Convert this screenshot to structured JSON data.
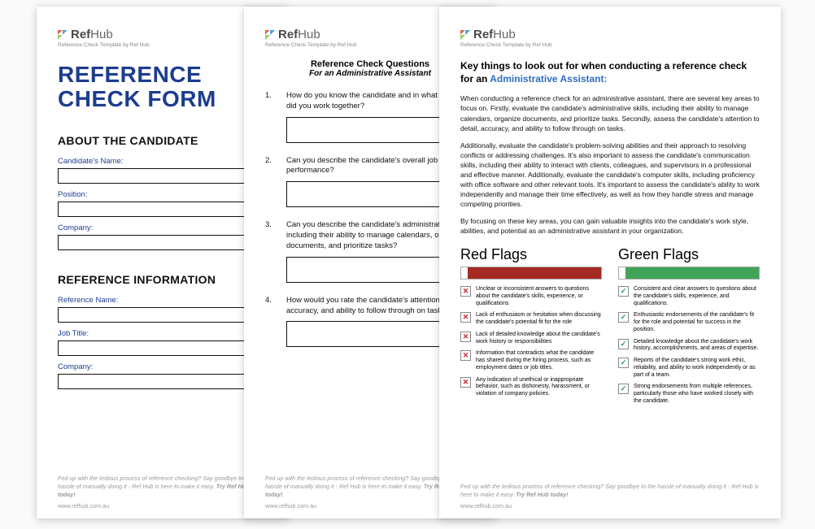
{
  "brand": {
    "name_bold": "Ref",
    "name_thin": "Hub",
    "tagline": "Reference Check Template by Ref Hub"
  },
  "footer": {
    "line": "Fed up with the tedious process of reference checking? Say goodbye to the hassle of manually doing it - Ref Hub is here to make it easy.",
    "cta": "Try Ref Hub today!",
    "url": "www.refhub.com.au"
  },
  "page1": {
    "title_l1": "REFERENCE",
    "title_l2": "CHECK FORM",
    "section_about": "ABOUT THE CANDIDATE",
    "fields_about": [
      "Candidate's Name:",
      "Position:",
      "Company:"
    ],
    "section_ref": "REFERENCE INFORMATION",
    "fields_ref": [
      "Reference Name:",
      "Job Title:",
      "Company:"
    ]
  },
  "page2": {
    "heading_l1": "Reference Check Questions",
    "heading_l2": "For an Administrative Assistant",
    "questions": [
      "How do you know the candidate and in what capacity did you work together?",
      "Can you describe the candidate's overall job performance?",
      "Can you describe the candidate's administrative skills, including their ability to manage calendars, organize documents, and prioritize tasks?",
      "How would you rate the candidate's attention to detail, accuracy, and ability to follow through on tasks?"
    ]
  },
  "page3": {
    "title_pre": "Key things to look out for when conducting a reference check for an ",
    "title_role": "Administrative Assistant:",
    "paras": [
      "When conducting a reference check for an administrative assistant, there are several key areas to focus on. Firstly, evaluate the candidate's administrative skills, including their ability to manage calendars, organize documents, and prioritize tasks. Secondly, assess the candidate's attention to detail, accuracy, and ability to follow through on tasks.",
      "Additionally, evaluate the candidate's problem-solving abilities and their approach to resolving conflicts or addressing challenges. It's also important to assess the candidate's communication skills, including their ability to interact with clients, colleagues, and supervisors in a professional and effective manner. Additionally, evaluate the candidate's computer skills, including proficiency with office software and other relevant tools. It's important to assess the candidate's ability to work independently and manage their time effectively, as well as how they handle stress and manage competing priorities.",
      "By focusing on these key areas, you can gain valuable insights into the candidate's work style, abilities, and potential as an administrative assistant in your organization."
    ],
    "red_h": "Red Flags",
    "green_h": "Green Flags",
    "red_flags": [
      "Unclear or inconsistent answers to questions about the candidate's skills, experience, or qualifications",
      "Lack of enthusiasm or hesitation when discussing the candidate's potential fit for the role",
      "Lack of detailed knowledge about the candidate's work history or responsibilities",
      "Information that contradicts what the candidate has shared during the hiring process, such as employment dates or job titles.",
      "Any indication of unethical or inappropriate behavior, such as dishonesty, harassment, or violation of company policies."
    ],
    "green_flags": [
      "Consistent and clear answers to questions about the candidate's skills, experience, and qualifications.",
      "Enthusiastic endorsements of the candidate's fit for the role and potential for success in the position.",
      "Detailed knowledge about the candidate's work history, accomplishments, and areas of expertise.",
      "Reports of the candidate's strong work ethic, reliability, and ability to work independently or as part of a team.",
      "Strong endorsements from multiple references, particularly those who have worked closely with the candidate."
    ]
  }
}
